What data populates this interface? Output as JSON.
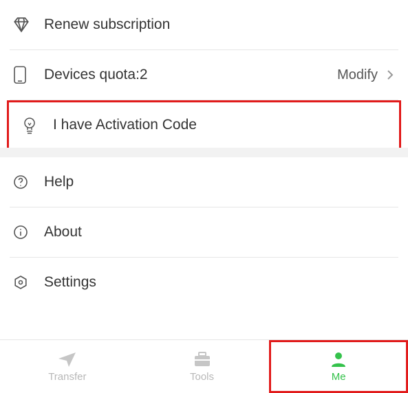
{
  "list": {
    "renew": {
      "label": "Renew subscription"
    },
    "devices": {
      "label": "Devices quota:2",
      "action": "Modify"
    },
    "activation": {
      "label": "I have Activation Code"
    },
    "help": {
      "label": "Help"
    },
    "about": {
      "label": "About"
    },
    "settings": {
      "label": "Settings"
    }
  },
  "tabs": {
    "transfer": {
      "label": "Transfer"
    },
    "tools": {
      "label": "Tools"
    },
    "me": {
      "label": "Me"
    }
  },
  "colors": {
    "accent": "#34c24b",
    "highlight": "#e11a1a"
  }
}
